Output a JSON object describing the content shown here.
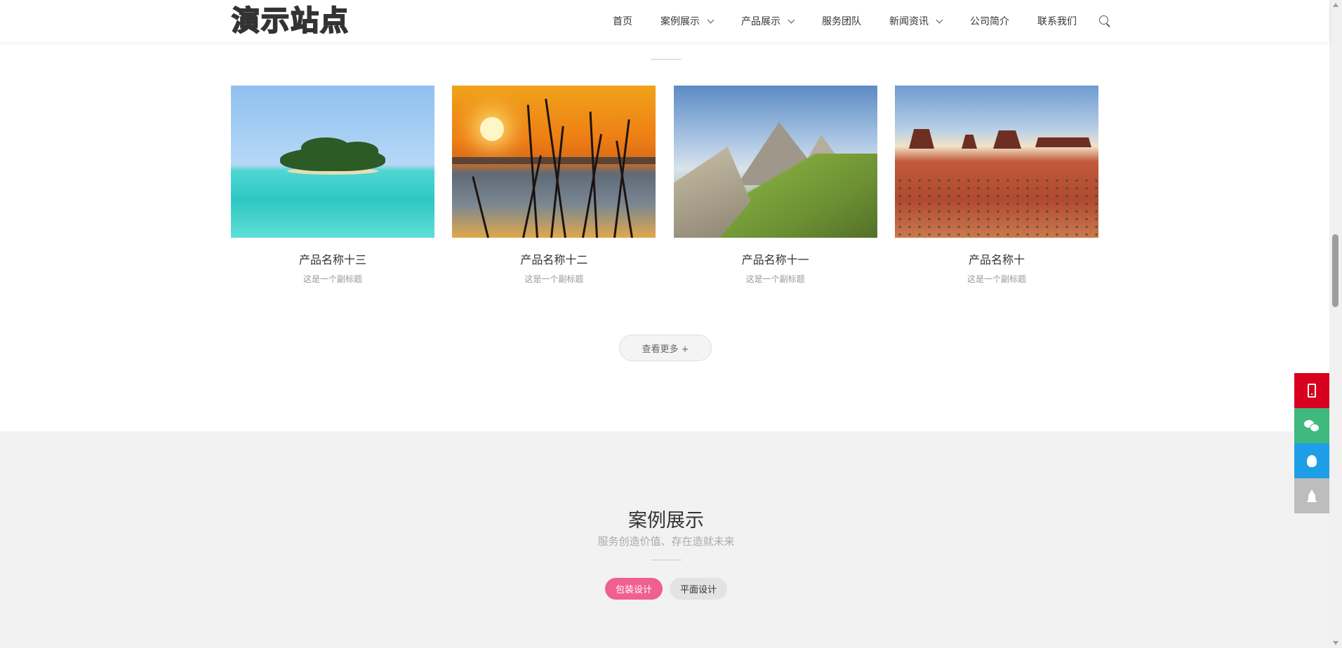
{
  "header": {
    "logo_text": "演示站点",
    "nav": [
      {
        "label": "首页",
        "has_dropdown": false
      },
      {
        "label": "案例展示",
        "has_dropdown": true
      },
      {
        "label": "产品展示",
        "has_dropdown": true
      },
      {
        "label": "服务团队",
        "has_dropdown": false
      },
      {
        "label": "新闻资讯",
        "has_dropdown": true
      },
      {
        "label": "公司简介",
        "has_dropdown": false
      },
      {
        "label": "联系我们",
        "has_dropdown": false
      }
    ],
    "search_icon": "search-icon"
  },
  "products_section": {
    "items": [
      {
        "title": "产品名称十三",
        "subtitle": "这是一个副标题",
        "image": "tropical-island"
      },
      {
        "title": "产品名称十二",
        "subtitle": "这是一个副标题",
        "image": "sunset-reeds"
      },
      {
        "title": "产品名称十一",
        "subtitle": "这是一个副标题",
        "image": "mountain-meadow"
      },
      {
        "title": "产品名称十",
        "subtitle": "这是一个副标题",
        "image": "desert-buttes"
      }
    ],
    "more_button": "查看更多 +"
  },
  "case_section": {
    "title": "案例展示",
    "subtitle": "服务创造价值、存在造就未来",
    "tabs": [
      {
        "label": "包装设计",
        "active": true
      },
      {
        "label": "平面设计",
        "active": false
      }
    ]
  },
  "float_bar": {
    "buttons": [
      "phone-icon",
      "wechat-icon",
      "qq-icon",
      "back-to-top-icon"
    ]
  },
  "colors": {
    "accent_pink": "#ef5f8f",
    "phone_red": "#d7001f",
    "wechat_green": "#3fb97d",
    "qq_blue": "#1f9ee8",
    "top_gray": "#bdbdbd"
  }
}
